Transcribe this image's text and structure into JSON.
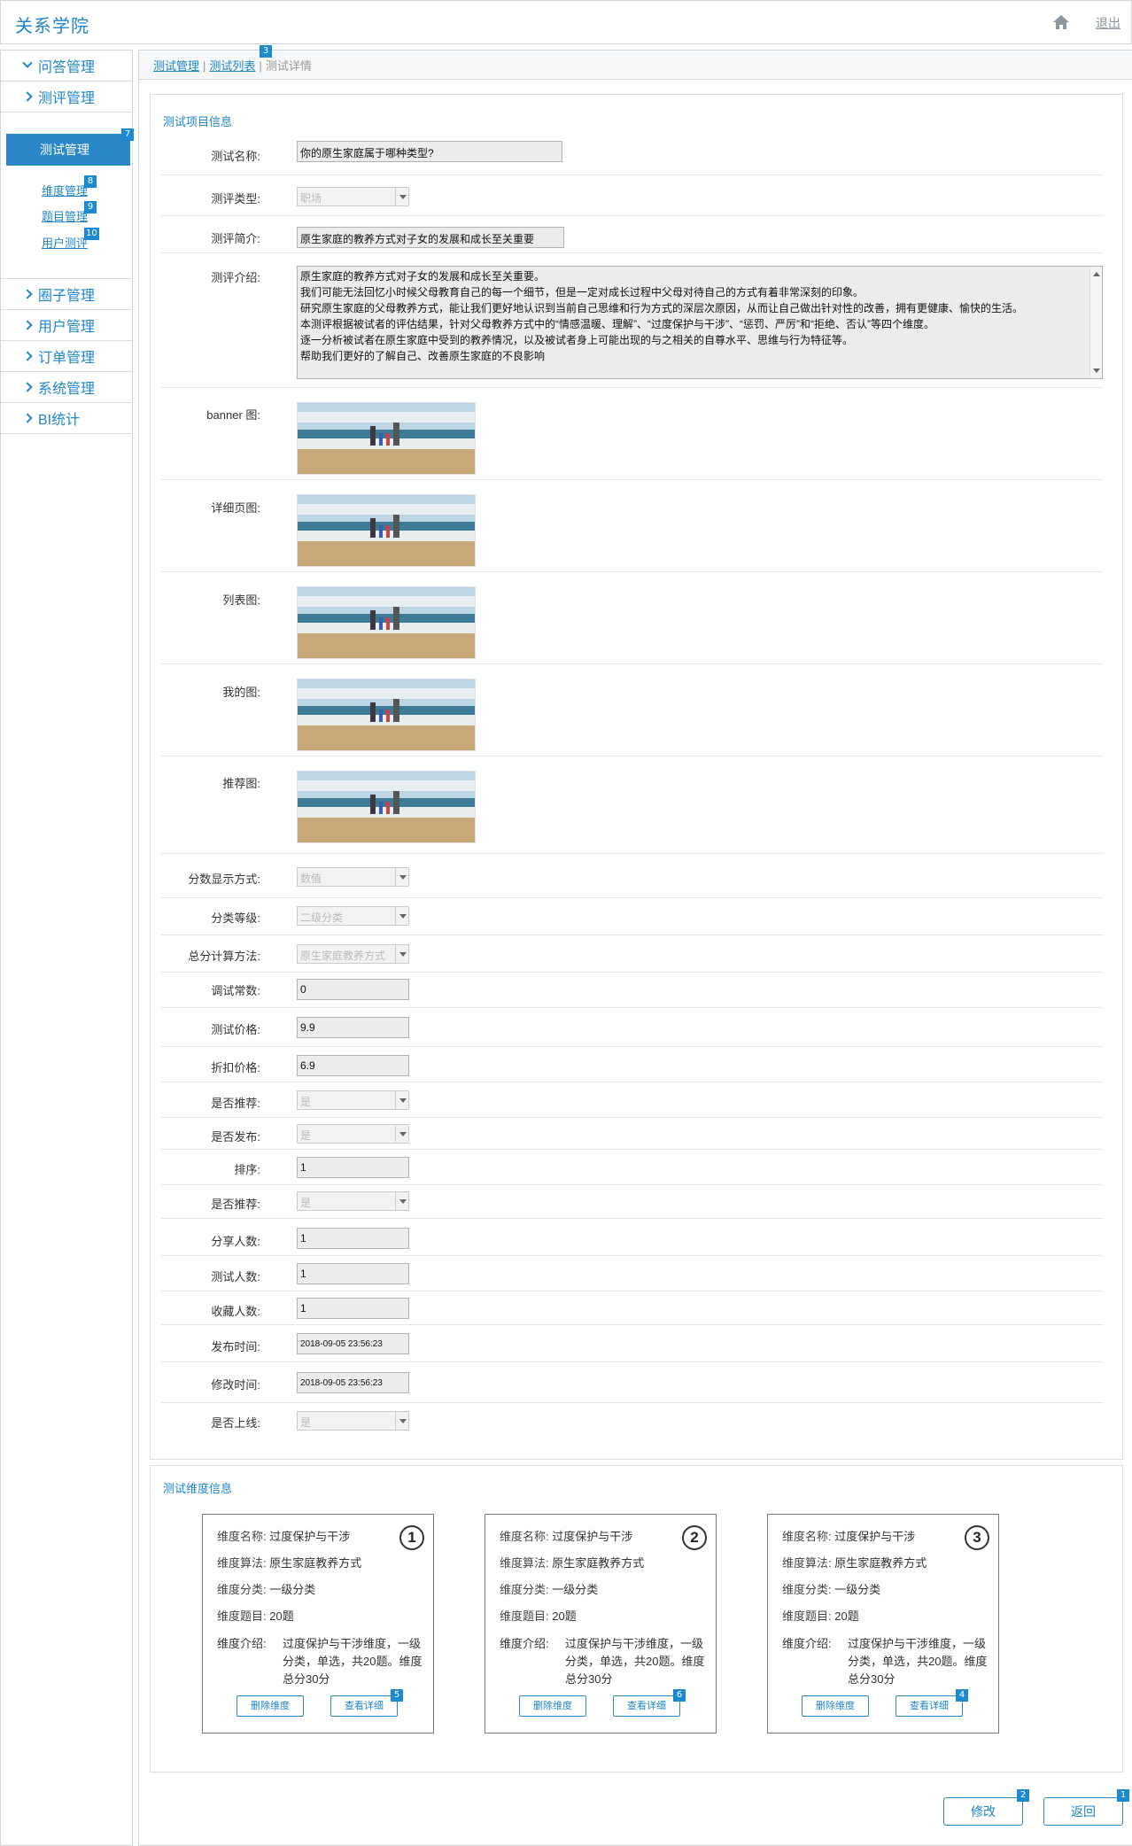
{
  "app": {
    "title": "关系学院",
    "logout": "退出",
    "home_icon": "home-icon"
  },
  "sidebar": {
    "groups": [
      {
        "label": "问答管理",
        "expanded": true
      },
      {
        "label": "测评管理",
        "expanded": false
      },
      {
        "label": "圈子管理"
      },
      {
        "label": "用户管理"
      },
      {
        "label": "订单管理"
      },
      {
        "label": "系统管理"
      },
      {
        "label": "BI统计"
      }
    ],
    "active": "测试管理",
    "subitems": [
      "维度管理",
      "题目管理",
      "用户测评"
    ]
  },
  "breadcrumb": [
    "测试管理",
    "测试列表",
    "测试详情"
  ],
  "badges": {
    "return": "1",
    "edit": "2",
    "list": "3",
    "card3": "4",
    "card1": "5",
    "card2": "6",
    "test_mgmt": "7",
    "dim": "8",
    "question": "9",
    "user_test": "10"
  },
  "info": {
    "title": "测试项目信息",
    "name_label": "测试名称:",
    "name_value": "你的原生家庭属于哪种类型?",
    "type_label": "测评类型:",
    "type_value": "职场",
    "brief_label": "测评简介:",
    "brief_value": "原生家庭的教养方式对子女的发展和成长至关重要",
    "intro_label": "测评介绍:",
    "intro_lines": [
      "原生家庭的教养方式对子女的发展和成长至关重要。",
      "我们可能无法回忆小时候父母教育自己的每一个细节，但是一定对成长过程中父母对待自己的方式有着非常深刻的印象。",
      "研究原生家庭的父母教养方式，能让我们更好地认识到当前自己思维和行为方式的深层次原因，从而让自己做出针对性的改善，拥有更健康、愉快的生活。",
      "本测评根据被试者的评估结果，针对父母教养方式中的“情感温暖、理解”、“过度保护与干涉”、“惩罚、严厉”和“拒绝、否认”等四个维度。",
      "逐一分析被试者在原生家庭中受到的教养情况，以及被试者身上可能出现的与之相关的自尊水平、思维与行为特征等。",
      "帮助我们更好的了解自己、改善原生家庭的不良影响"
    ],
    "banner_label": "banner 图:",
    "detail_label": "详细页图:",
    "list_label": "列表图:",
    "mine_label": "我的图:",
    "recommend_pic_label": "推荐图:",
    "score_label": "分数显示方式:",
    "score_value": "数值",
    "level_label": "分类等级:",
    "level_value": "二级分类",
    "calc_label": "总分计算方法:",
    "calc_value": "原生家庭教养方式",
    "const_label": "调试常数:",
    "const_value": "0",
    "price_label": "测试价格:",
    "price_value": "9.9",
    "discount_label": "折扣价格:",
    "discount_value": "6.9",
    "recommend_label": "是否推荐:",
    "recommend_value": "是",
    "publish_label": "是否发布:",
    "publish_value": "是",
    "sort_label": "排序:",
    "sort_value": "1",
    "recommend2_label": "是否推荐:",
    "recommend2_value": "是",
    "share_label": "分享人数:",
    "share_value": "1",
    "testers_label": "测试人数:",
    "testers_value": "1",
    "fav_label": "收藏人数:",
    "fav_value": "1",
    "pubtime_label": "发布时间:",
    "pubtime_value": "2018-09-05 23:56:23",
    "modtime_label": "修改时间:",
    "modtime_value": "2018-09-05 23:56:23",
    "online_label": "是否上线:",
    "online_value": "是"
  },
  "dims": {
    "title": "测试维度信息",
    "keys": {
      "name": "维度名称:",
      "algo": "维度算法:",
      "cat": "维度分类:",
      "q": "维度题目:",
      "intro": "维度介绍:"
    },
    "delete_label": "删除维度",
    "view_label": "查看详细",
    "cards": [
      {
        "num": "1",
        "name": "过度保护与干涉",
        "algo": "原生家庭教养方式",
        "cat": "一级分类",
        "q": "20题",
        "intro": "过度保护与干涉维度，一级分类，单选，共20题。维度总分30分"
      },
      {
        "num": "2",
        "name": "过度保护与干涉",
        "algo": "原生家庭教养方式",
        "cat": "一级分类",
        "q": "20题",
        "intro": "过度保护与干涉维度，一级分类，单选，共20题。维度总分30分"
      },
      {
        "num": "3",
        "name": "过度保护与干涉",
        "algo": "原生家庭教养方式",
        "cat": "一级分类",
        "q": "20题",
        "intro": "过度保护与干涉维度，一级分类，单选，共20题。维度总分30分"
      }
    ]
  },
  "actions": {
    "edit": "修改",
    "back": "返回"
  }
}
